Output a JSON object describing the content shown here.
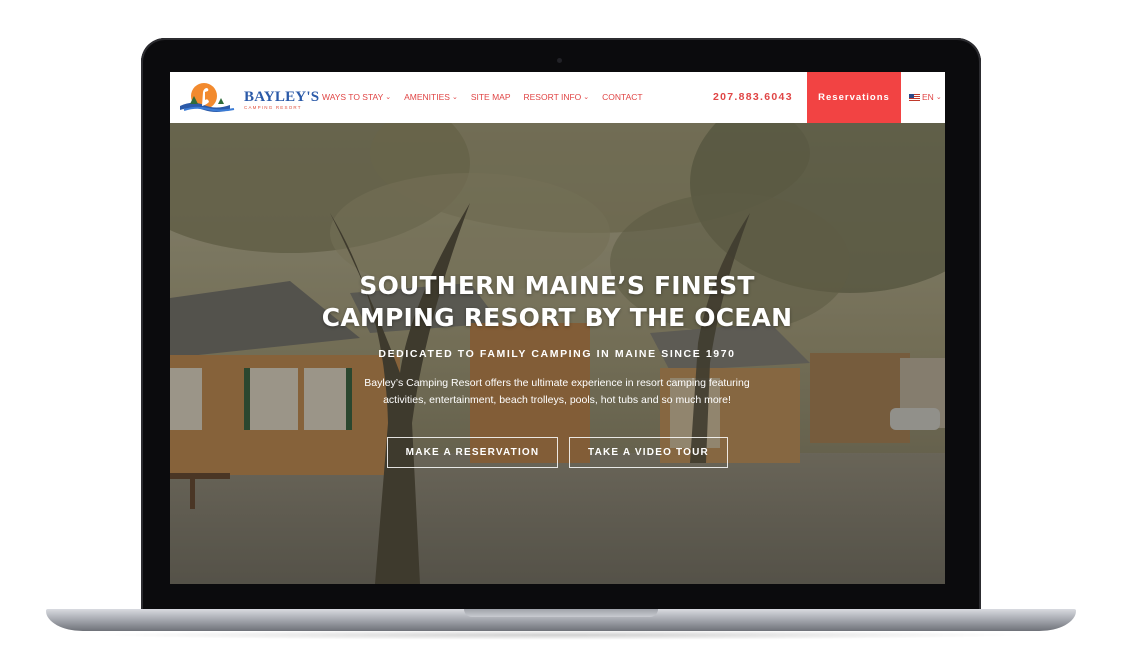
{
  "brand": {
    "name": "BAYLEY'S",
    "tagline": "CAMPING RESORT"
  },
  "nav": {
    "items": [
      {
        "label": "WAYS TO STAY",
        "has_dropdown": true
      },
      {
        "label": "AMENITIES",
        "has_dropdown": true
      },
      {
        "label": "SITE MAP",
        "has_dropdown": false
      },
      {
        "label": "RESORT INFO",
        "has_dropdown": true
      },
      {
        "label": "CONTACT",
        "has_dropdown": false
      }
    ],
    "phone": "207.883.6043",
    "reserve_label": "Reservations",
    "language": "EN"
  },
  "hero": {
    "title_line1": "SOUTHERN MAINE’S FINEST",
    "title_line2": "CAMPING RESORT BY THE OCEAN",
    "subtitle": "DEDICATED TO FAMILY CAMPING IN MAINE SINCE 1970",
    "description_line1": "Bayley’s Camping Resort offers the ultimate experience in resort camping featuring",
    "description_line2": "activities, entertainment, beach trolleys, pools, hot tubs and so much more!",
    "button_reserve": "MAKE A RESERVATION",
    "button_video": "TAKE A VIDEO TOUR"
  },
  "colors": {
    "accent": "#f24343",
    "nav_text": "#e04545",
    "logo_blue": "#2b5aa8",
    "hero_text": "#ffffff"
  },
  "icons": [
    "heron-logo-icon",
    "chevron-down-icon",
    "us-flag-icon"
  ]
}
